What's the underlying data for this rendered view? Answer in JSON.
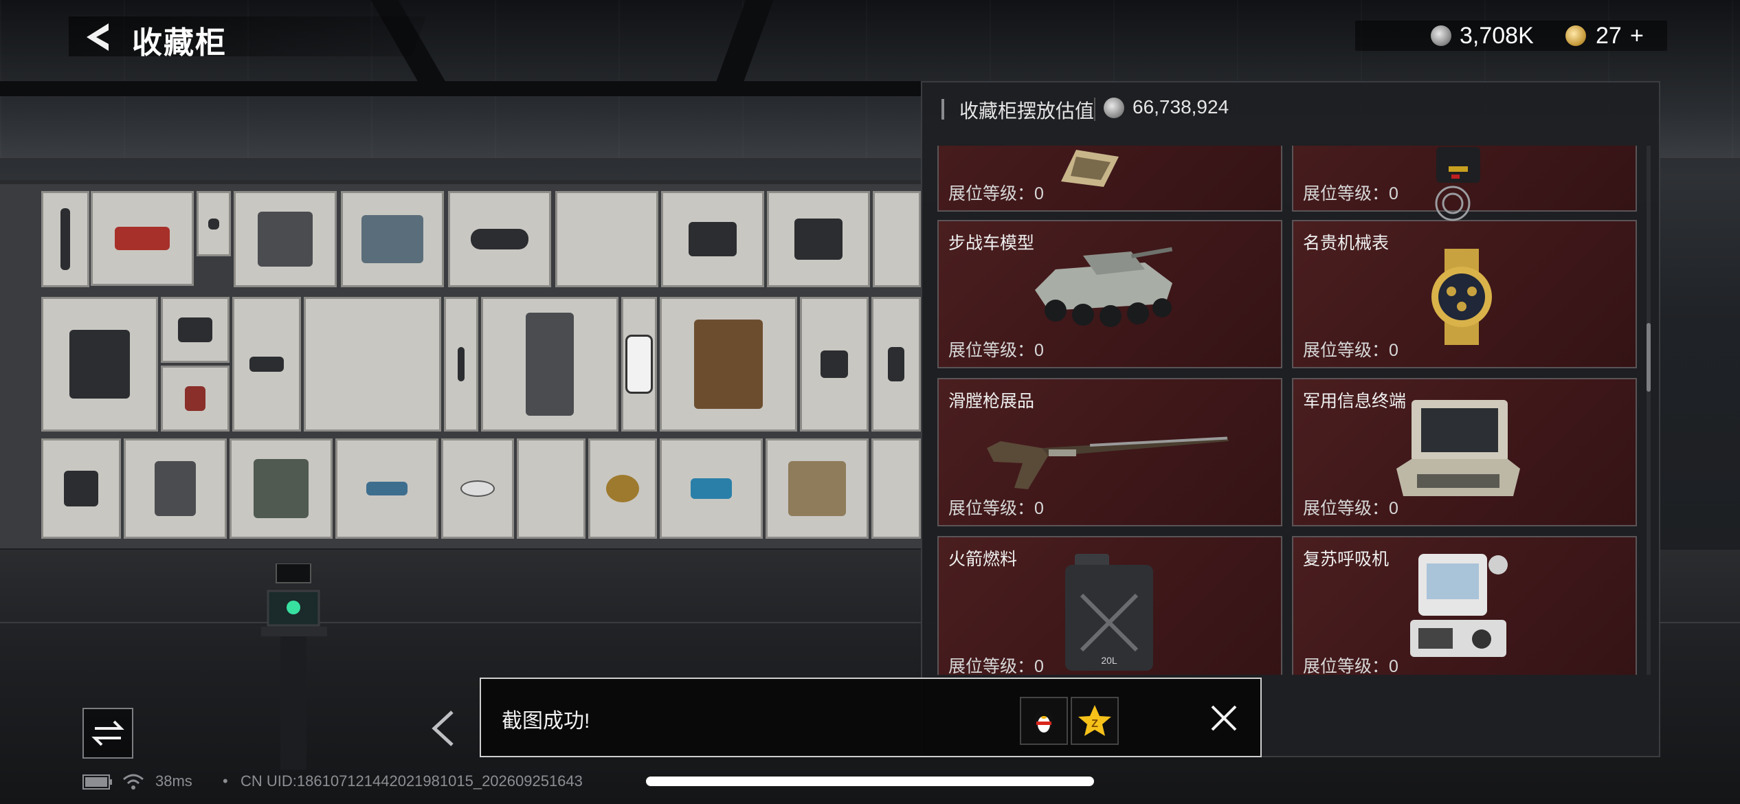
{
  "header": {
    "title": "收藏柜",
    "silver_amount": "3,708K",
    "gold_amount": "27",
    "gold_plus": "+"
  },
  "panel": {
    "label": "收藏柜摆放估值",
    "value": "66,738,924",
    "cards": [
      {
        "name": "",
        "level": "展位等级：0",
        "icon": "ornate-box-icon"
      },
      {
        "name": "",
        "level": "展位等级：0",
        "icon": "case-icon"
      },
      {
        "name": "步战车模型",
        "level": "展位等级：0",
        "icon": "armored-vehicle-icon"
      },
      {
        "name": "名贵机械表",
        "level": "展位等级：0",
        "icon": "watch-icon"
      },
      {
        "name": "滑膛枪展品",
        "level": "展位等级：0",
        "icon": "musket-icon"
      },
      {
        "name": "军用信息终端",
        "level": "展位等级：0",
        "icon": "terminal-icon"
      },
      {
        "name": "火箭燃料",
        "level": "展位等级：0",
        "icon": "fuel-can-icon"
      },
      {
        "name": "复苏呼吸机",
        "level": "展位等级：0",
        "icon": "ventilator-icon"
      }
    ],
    "fuel_can_text": "20L"
  },
  "toast": {
    "message": "截图成功!"
  },
  "status": {
    "ping": "38ms",
    "uid": "CN UID:1861071214420219810​15_202609251643"
  },
  "colors": {
    "card_bg": "#3e1719",
    "panel_bg": "#1e1f22",
    "toast_border": "#cfcfcf",
    "accent_gold": "#c59a3a"
  }
}
